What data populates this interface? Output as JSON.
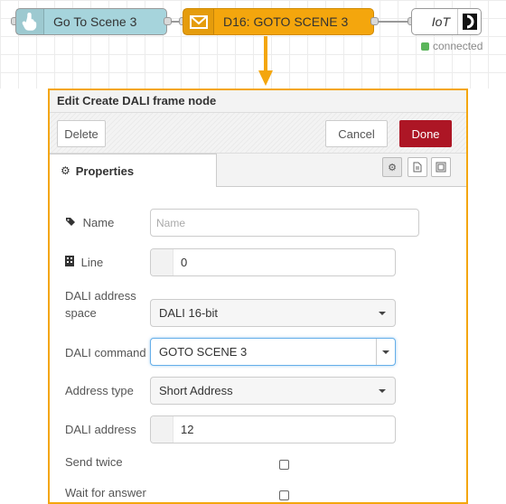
{
  "flow": {
    "nodes": [
      {
        "label": "Go To Scene 3",
        "icon": "hand-pointer-icon"
      },
      {
        "label": "D16: GOTO SCENE 3",
        "icon": "envelope-icon"
      },
      {
        "label": "IoT",
        "icon": "iot-logo-icon"
      }
    ],
    "status_text": "connected",
    "status_color": "#5ab55a",
    "accent_color": "#f4a60d"
  },
  "panel": {
    "title": "Edit Create DALI frame node",
    "buttons": {
      "delete": "Delete",
      "cancel": "Cancel",
      "done": "Done"
    },
    "tab_label": "Properties",
    "tab_icons": [
      "gear-icon",
      "description-icon",
      "appearance-icon"
    ]
  },
  "form": {
    "name": {
      "label": "Name",
      "placeholder": "Name",
      "value": ""
    },
    "line": {
      "label": "Line",
      "value": "0"
    },
    "address_space": {
      "label_line1": "DALI address",
      "label_line2": "space",
      "value": "DALI 16-bit"
    },
    "command": {
      "label": "DALI command",
      "value": "GOTO SCENE 3"
    },
    "address_type": {
      "label": "Address type",
      "value": "Short Address"
    },
    "address": {
      "label": "DALI address",
      "value": "12"
    },
    "send_twice": {
      "label": "Send twice",
      "checked": false
    },
    "wait_answer": {
      "label": "Wait for answer",
      "checked": false
    }
  }
}
